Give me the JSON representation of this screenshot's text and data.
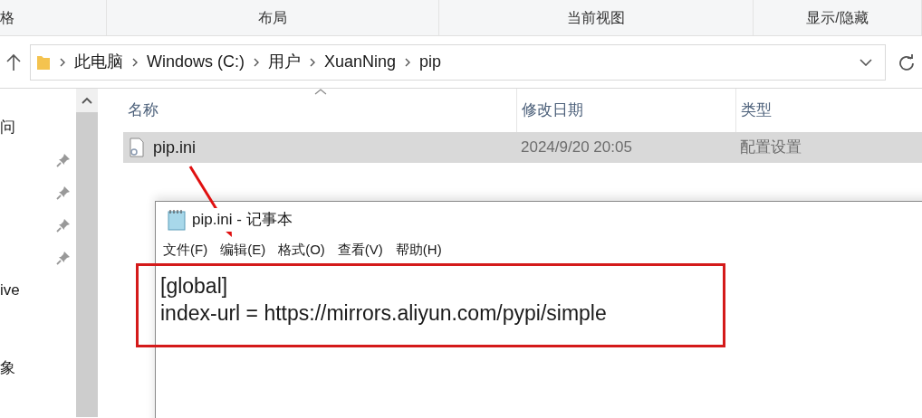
{
  "ribbon": {
    "groups": [
      "格",
      "布局",
      "当前视图",
      "显示/隐藏"
    ]
  },
  "address_bar": {
    "path": [
      "此电脑",
      "Windows (C:)",
      "用户",
      "XuanNing",
      "pip"
    ]
  },
  "nav_pane": {
    "items": [
      {
        "kind": "text",
        "label": "问"
      },
      {
        "kind": "pin"
      },
      {
        "kind": "pin"
      },
      {
        "kind": "pin"
      },
      {
        "kind": "pin"
      },
      {
        "kind": "text",
        "label": "ive"
      },
      {
        "kind": "blank"
      },
      {
        "kind": "text",
        "label": "象"
      }
    ]
  },
  "file_list": {
    "columns": [
      "名称",
      "修改日期",
      "类型"
    ],
    "rows": [
      {
        "name": "pip.ini",
        "modified": "2024/9/20 20:05",
        "type": "配置设置",
        "selected": true
      }
    ]
  },
  "notepad": {
    "title": "pip.ini - 记事本",
    "menu": [
      "文件(F)",
      "编辑(E)",
      "格式(O)",
      "查看(V)",
      "帮助(H)"
    ],
    "lines": [
      "[global]",
      "index-url = https://mirrors.aliyun.com/pypi/simple"
    ]
  }
}
